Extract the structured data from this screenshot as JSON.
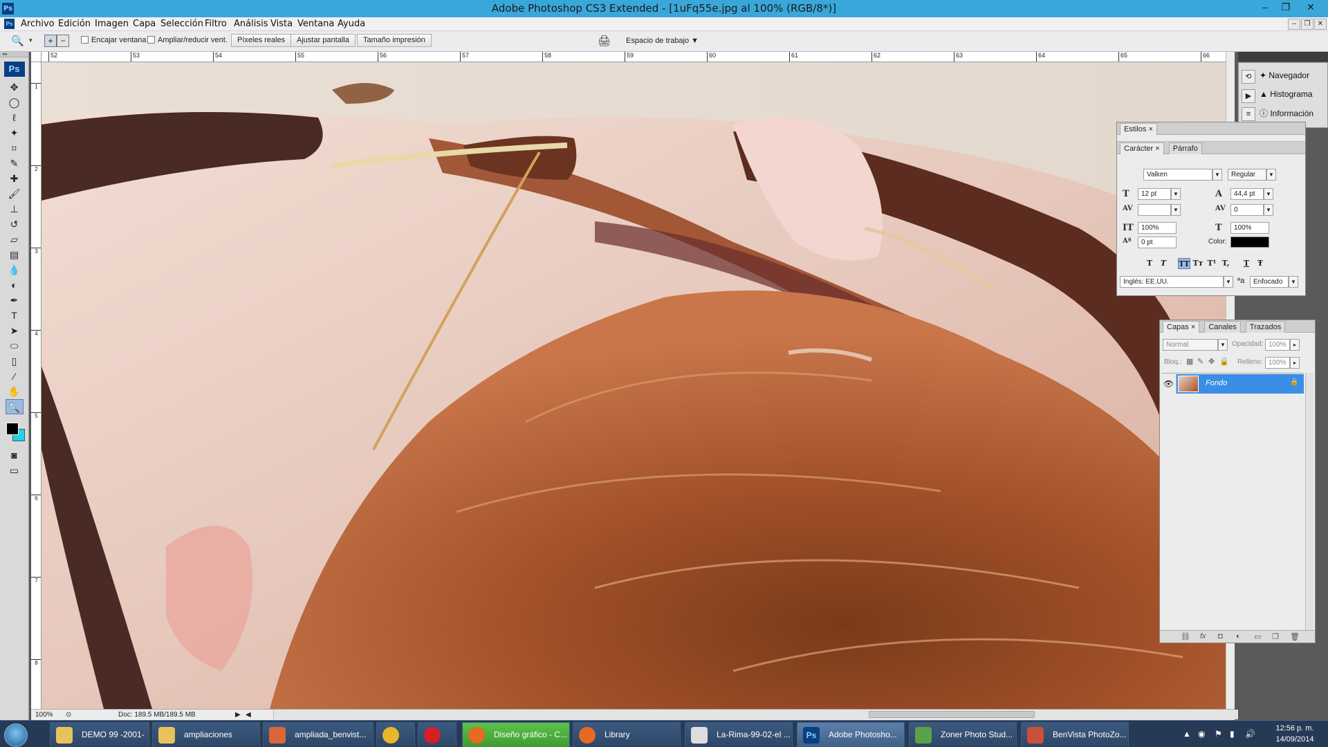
{
  "app": {
    "title": "Adobe Photoshop CS3 Extended - [1uFq55e.jpg al 100% (RGB/8*)]",
    "icon": "Ps"
  },
  "window_controls": {
    "minimize": "–",
    "restore": "❐",
    "close": "✕"
  },
  "menu": [
    "Archivo",
    "Edición",
    "Imagen",
    "Capa",
    "Selección",
    "Filtro",
    "Análisis",
    "Vista",
    "Ventana",
    "Ayuda"
  ],
  "options_bar": {
    "checkbox_fit_window": "Encajar ventana",
    "checkbox_resize": "Ampliar/reducir vent.",
    "btn_actual_pixels": "Píxeles reales",
    "btn_fit_screen": "Ajustar pantalla",
    "btn_print_size": "Tamaño impresión",
    "workspace": "Espacio de trabajo"
  },
  "rulers": {
    "top": [
      "52",
      "53",
      "54",
      "55",
      "56",
      "57",
      "58",
      "59",
      "60",
      "61",
      "62",
      "63",
      "64",
      "65",
      "66"
    ],
    "left": [
      "1",
      "2",
      "3",
      "4",
      "5",
      "6",
      "7",
      "8",
      "9"
    ]
  },
  "status": {
    "zoom": "100%",
    "doc": "Doc: 189.5 MB/189.5 MB"
  },
  "dock_panels": [
    {
      "icon": "navigator-icon",
      "label": "Navegador"
    },
    {
      "icon": "histogram-icon",
      "label": "Histograma"
    },
    {
      "icon": "info-icon",
      "label": "Información"
    }
  ],
  "styles_panel": {
    "tab": "Estilos"
  },
  "character_panel": {
    "tab_character": "Carácter",
    "tab_paragraph": "Párrafo",
    "font_family": "Valken",
    "font_style": "Regular",
    "font_size": "12 pt",
    "leading": "44,4 pt",
    "kerning": "",
    "tracking": "0",
    "vertical_scale": "100%",
    "horizontal_scale": "100%",
    "baseline_shift": "0 pt",
    "color_label": "Color:",
    "color_value": "#000000",
    "format_buttons": [
      "T",
      "T",
      "TT",
      "Tт",
      "T¹",
      "T,",
      "T",
      "Ŧ"
    ],
    "language": "Inglés: EE.UU.",
    "antialias_icon": "ªa",
    "antialias": "Enfocado"
  },
  "layers_panel": {
    "tabs": [
      "Capas",
      "Canales",
      "Trazados"
    ],
    "blend_mode": "Normal",
    "opacity_label": "Opacidad:",
    "opacity": "100%",
    "lock_label": "Bloq.:",
    "fill_label": "Relleno:",
    "fill": "100%",
    "layers": [
      {
        "name": "Fondo",
        "visible": true,
        "locked": true
      }
    ]
  },
  "taskbar": {
    "items": [
      {
        "label": "DEMO 99 -2001-",
        "icon": "folder-icon"
      },
      {
        "label": "ampliaciones",
        "icon": "folder-icon"
      },
      {
        "label": "ampliada_benvist...",
        "icon": "benvista-icon"
      },
      {
        "label": "",
        "icon": "chrome-icon"
      },
      {
        "label": "",
        "icon": "opera-icon"
      },
      {
        "label": "Diseño gráfico - C...",
        "icon": "firefox-icon"
      },
      {
        "label": "Library",
        "icon": "firefox-icon"
      },
      {
        "label": "La-Rima-99-02-el ...",
        "icon": "panda-icon"
      },
      {
        "label": "Adobe Photosho...",
        "icon": "photoshop-icon"
      },
      {
        "label": "Zoner Photo Stud...",
        "icon": "zoner-icon"
      },
      {
        "label": "BenVista PhotoZo...",
        "icon": "benvista-icon"
      }
    ],
    "time": "12:56 p. m.",
    "date": "14/09/2014"
  },
  "colors": {
    "titlebar": "#3aa7db",
    "foreground": "#000000",
    "background": "#1fd3e8",
    "layer_selected": "#3b8ee6"
  }
}
